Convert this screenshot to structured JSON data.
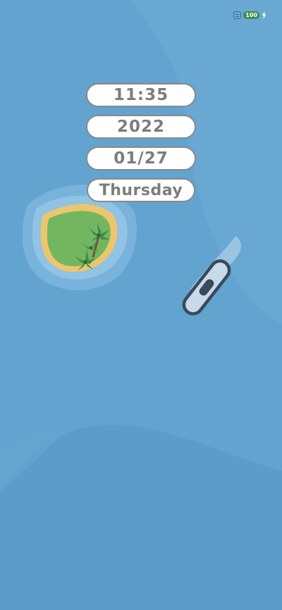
{
  "status_bar": {
    "battery_level": "100",
    "charging_icon": "lightning-bolt-icon",
    "notification_icon": "message-icon"
  },
  "widget": {
    "time": "11:35",
    "year": "2022",
    "date": "01/27",
    "weekday": "Thursday"
  },
  "colors": {
    "ocean": "#62a3cf",
    "island_grass": "#73b660",
    "island_sand": "#ecc66d",
    "boat": "#3a4a5a"
  }
}
